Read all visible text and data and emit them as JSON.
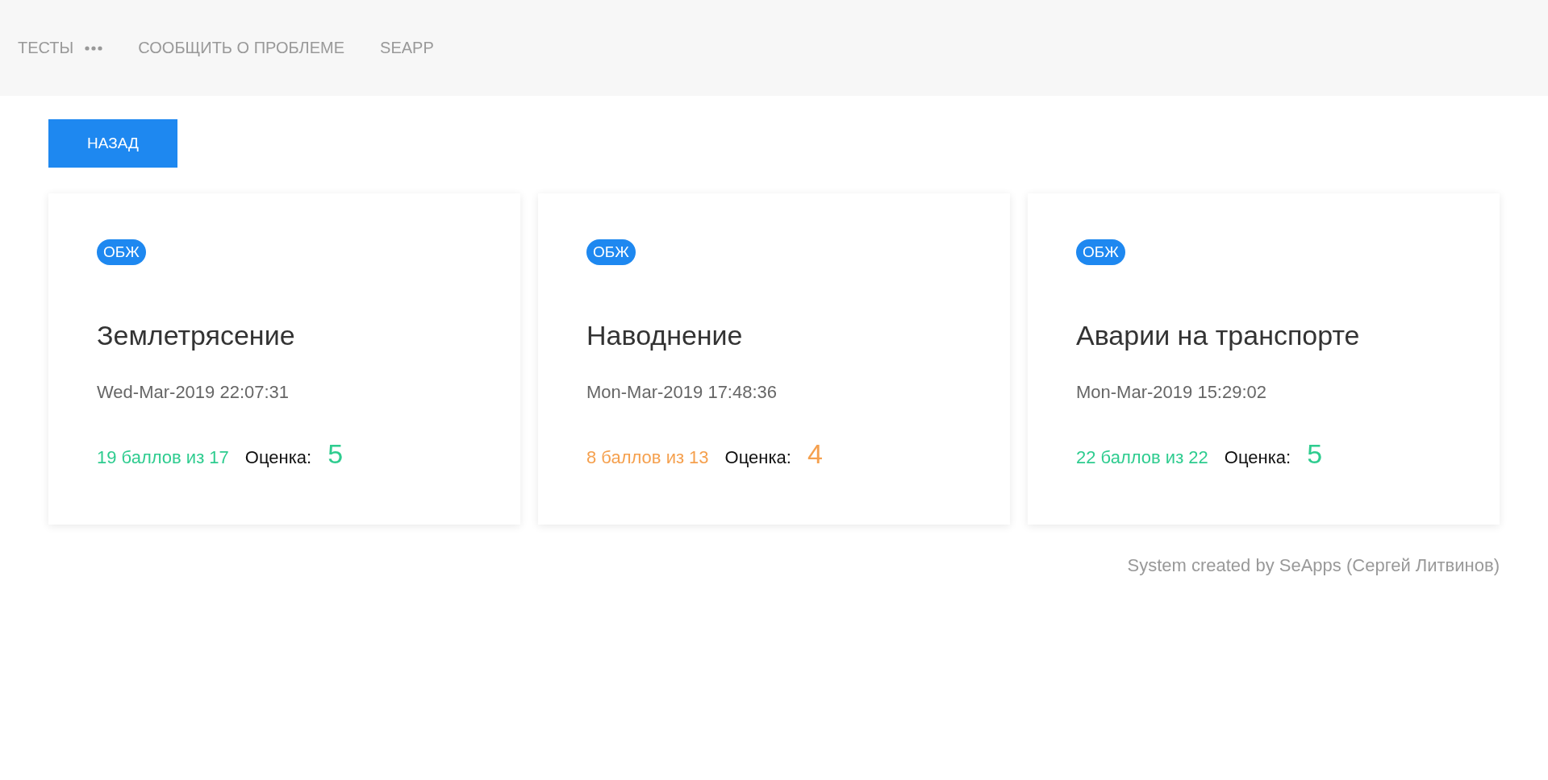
{
  "nav": {
    "items": [
      {
        "label": "ТЕСТЫ",
        "kind": "dropdown"
      },
      {
        "label": "СООБЩИТЬ О ПРОБЛЕМЕ",
        "kind": "link"
      },
      {
        "label": "SEAPP",
        "kind": "link"
      }
    ]
  },
  "back_button": "НАЗАД",
  "results": [
    {
      "tag": "ОБЖ",
      "title": "Землетрясение",
      "date": "Wed-Mar-2019 22:07:31",
      "score": "19 баллов из 17",
      "grade_label": "Оценка:",
      "grade": "5",
      "color": "#2ecc8f"
    },
    {
      "tag": "ОБЖ",
      "title": "Наводнение",
      "date": "Mon-Mar-2019 17:48:36",
      "score": "8 баллов из 13",
      "grade_label": "Оценка:",
      "grade": "4",
      "color": "#f5a04e"
    },
    {
      "tag": "ОБЖ",
      "title": "Аварии на транспорте",
      "date": "Mon-Mar-2019 15:29:02",
      "score": "22 баллов из 22",
      "grade_label": "Оценка:",
      "grade": "5",
      "color": "#2ecc8f"
    }
  ],
  "footer": "System created by SeApps (Сергей Литвинов)"
}
